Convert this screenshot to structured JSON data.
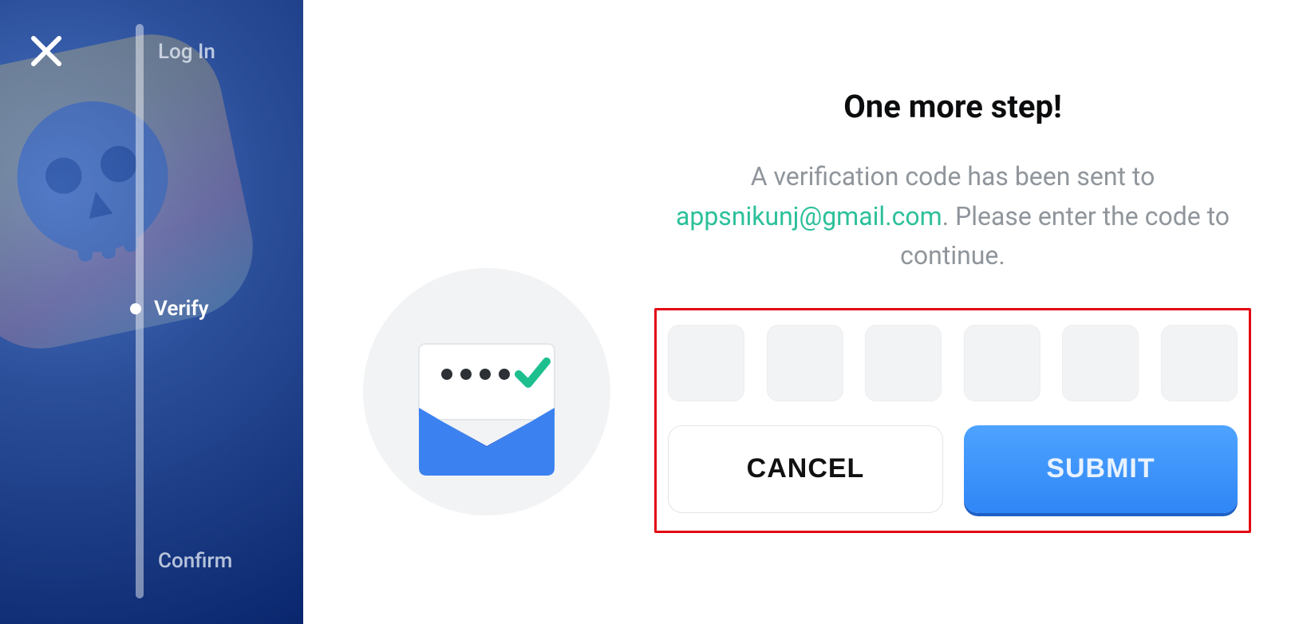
{
  "sidebar": {
    "steps": {
      "login": "Log In",
      "verify": "Verify",
      "confirm": "Confirm"
    },
    "active_step": "verify"
  },
  "main": {
    "title": "One more step!",
    "subtitle_before": "A verification code has been sent to ",
    "email": "appsnikunj@gmail.com",
    "subtitle_after": ". Please enter the code to continue.",
    "code_length": 6,
    "cancel_label": "CANCEL",
    "submit_label": "SUBMIT"
  },
  "colors": {
    "accent_green": "#2cc09a",
    "button_blue": "#2f86f5",
    "highlight_red": "#e30613"
  }
}
